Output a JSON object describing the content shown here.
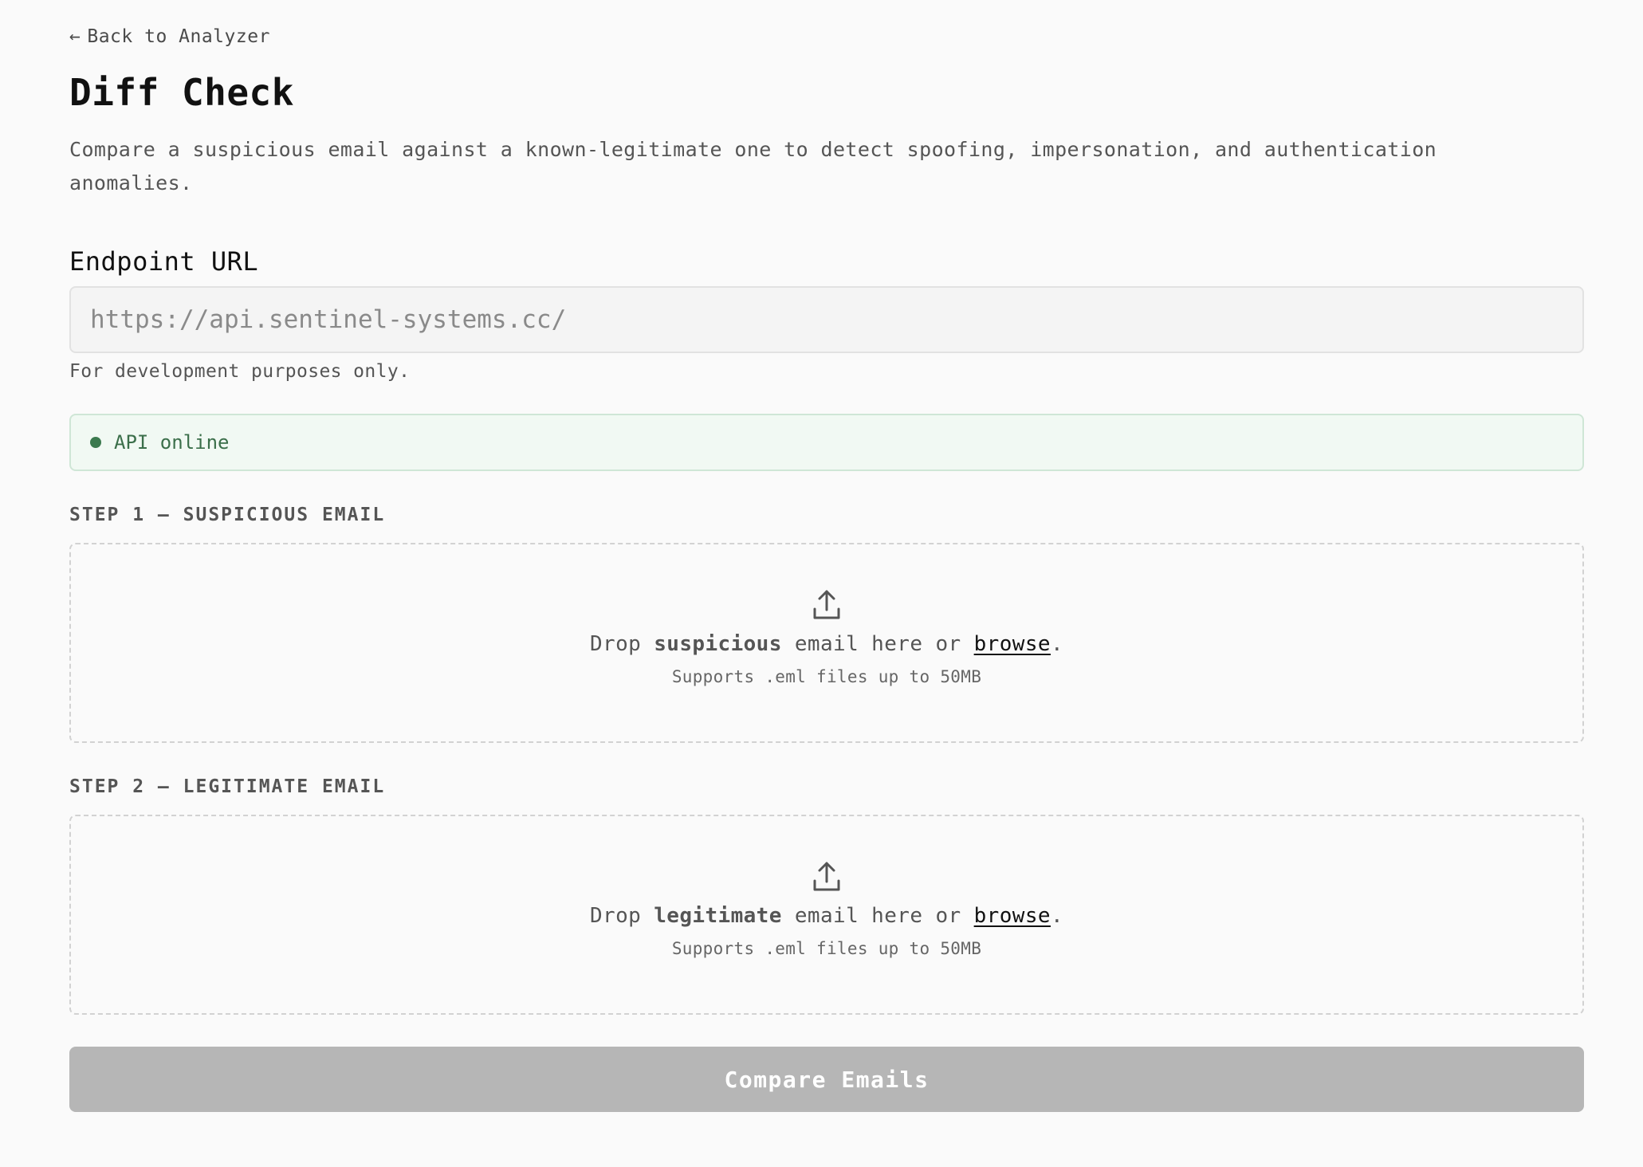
{
  "nav": {
    "back_arrow": "←",
    "back_label": "Back to Analyzer"
  },
  "header": {
    "title": "Diff Check",
    "subtitle": "Compare a suspicious email against a known-legitimate one to detect spoofing, impersonation, and authentication anomalies."
  },
  "endpoint": {
    "label": "Endpoint URL",
    "placeholder": "https://api.sentinel-systems.cc/",
    "value": "",
    "note": "For development purposes only."
  },
  "status": {
    "text": "API online",
    "color": "#3b7a4e"
  },
  "steps": [
    {
      "label": "STEP 1 — SUSPICIOUS EMAIL",
      "drop_prefix": "Drop",
      "drop_emphasis": "suspicious",
      "drop_middle": "email here or",
      "browse_label": "browse",
      "drop_suffix": ".",
      "hint": "Supports .eml files up to 50MB",
      "icon": "upload-icon"
    },
    {
      "label": "STEP 2 — LEGITIMATE EMAIL",
      "drop_prefix": "Drop",
      "drop_emphasis": "legitimate",
      "drop_middle": "email here or",
      "browse_label": "browse",
      "drop_suffix": ".",
      "hint": "Supports .eml files up to 50MB",
      "icon": "upload-icon"
    }
  ],
  "actions": {
    "compare_label": "Compare Emails",
    "compare_disabled": true,
    "compare_color": "#b6b6b6"
  }
}
